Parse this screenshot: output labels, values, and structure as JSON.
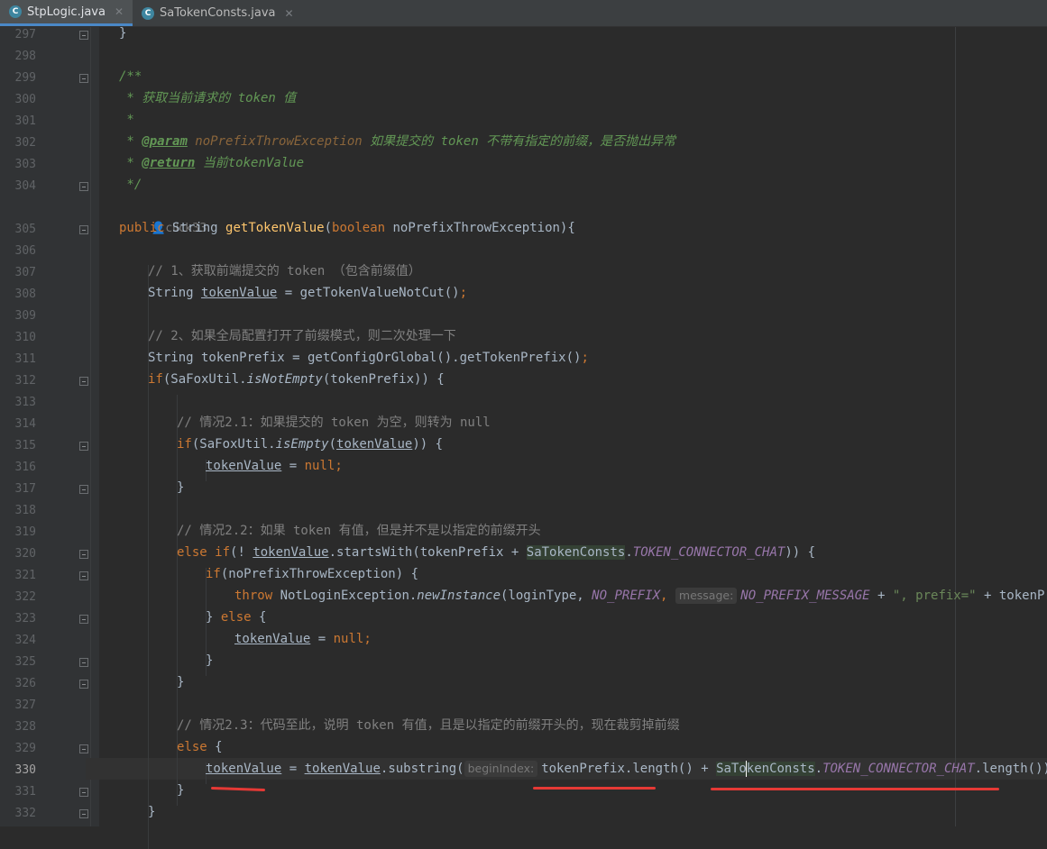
{
  "tabs": [
    {
      "label": "StpLogic.java",
      "icon": "C",
      "active": true
    },
    {
      "label": "SaTokenConsts.java",
      "icon": "C",
      "active": false
    }
  ],
  "gutter": [
    {
      "n": "297"
    },
    {
      "n": "298"
    },
    {
      "n": "299"
    },
    {
      "n": "300"
    },
    {
      "n": "301"
    },
    {
      "n": "302"
    },
    {
      "n": "303"
    },
    {
      "n": "304"
    },
    {
      "n": ""
    },
    {
      "n": "305"
    },
    {
      "n": "306"
    },
    {
      "n": "307"
    },
    {
      "n": "308"
    },
    {
      "n": "309"
    },
    {
      "n": "310"
    },
    {
      "n": "311"
    },
    {
      "n": "312"
    },
    {
      "n": "313"
    },
    {
      "n": "314"
    },
    {
      "n": "315"
    },
    {
      "n": "316"
    },
    {
      "n": "317"
    },
    {
      "n": "318"
    },
    {
      "n": "319"
    },
    {
      "n": "320"
    },
    {
      "n": "321"
    },
    {
      "n": "322"
    },
    {
      "n": "323"
    },
    {
      "n": "324"
    },
    {
      "n": "325"
    },
    {
      "n": "326"
    },
    {
      "n": "327"
    },
    {
      "n": "328"
    },
    {
      "n": "329"
    },
    {
      "n": "330",
      "current": true
    },
    {
      "n": "331"
    },
    {
      "n": "332"
    }
  ],
  "code": {
    "l297": "}",
    "l299": "/**",
    "l300": " * 获取当前请求的 token 值",
    "l301": " *",
    "l302_star": " * ",
    "l302_tag": "@param",
    "l302_ref": " noPrefixThrowException",
    "l302_text": " 如果提交的 token 不带有指定的前缀，是否抛出异常",
    "l303_star": " * ",
    "l303_tag": "@return",
    "l303_text": " 当前tokenValue",
    "l304": " */",
    "author_icon": "user-icon",
    "author": "click33",
    "l305": {
      "kw1": "public ",
      "type": "String ",
      "name": "getTokenValue",
      "p1": "(",
      "kw2": "boolean",
      "rest": " noPrefixThrowException){"
    },
    "l307": "// 1、获取前端提交的 token （包含前缀值）",
    "l308": {
      "type": "String ",
      "var": "tokenValue",
      "rest": " = getTokenValueNotCut()",
      "semi": ";"
    },
    "l310": "// 2、如果全局配置打开了前缀模式，则二次处理一下",
    "l311": {
      "type": "String tokenPrefix = getConfigOrGlobal().getTokenPrefix()",
      "semi": ";"
    },
    "l312": {
      "kw": "if",
      "a": "(SaFoxUtil.",
      "m": "isNotEmpty",
      "b": "(tokenPrefix)) {"
    },
    "l314": "// 情况2.1：如果提交的 token 为空，则转为 null",
    "l315": {
      "kw": "if",
      "a": "(SaFoxUtil.",
      "m": "isEmpty",
      "b": "(",
      "var": "tokenValue",
      "c": ")) {"
    },
    "l316": {
      "var": "tokenValue",
      "eq": " = ",
      "kw": "null",
      "semi": ";"
    },
    "l317": "}",
    "l319": "// 情况2.2：如果 token 有值，但是并不是以指定的前缀开头",
    "l320": {
      "kw": "else if",
      "a": "(! ",
      "var": "tokenValue",
      "b": ".startsWith(tokenPrefix + ",
      "cls": "SaTokenConsts",
      "dot": ".",
      "const": "TOKEN_CONNECTOR_CHAT",
      "c": ")) {"
    },
    "l321": {
      "kw": "if",
      "rest": "(noPrefixThrowException) {"
    },
    "l322": {
      "kw": "throw ",
      "a": "NotLoginException.",
      "m": "newInstance",
      "b": "(loginType, ",
      "c1": "NO_PREFIX",
      "comma": ", ",
      "hint": "message:",
      "c2": "NO_PREFIX_MESSAGE",
      "plus": " + ",
      "str": "\", prefix=\"",
      "tail": " + tokenPrefix, "
    },
    "l323": {
      "a": "} ",
      "kw": "else",
      "b": " {"
    },
    "l324": {
      "var": "tokenValue",
      "eq": " = ",
      "kw": "null",
      "semi": ";"
    },
    "l325": "}",
    "l326": "}",
    "l328": "// 情况2.3：代码至此，说明 token 有值，且是以指定的前缀开头的，现在裁剪掉前缀",
    "l329": {
      "kw": "else",
      "b": " {"
    },
    "l330": {
      "var1": "tokenValue",
      "eq": " = ",
      "var2": "tokenValue",
      "a": ".substring(",
      "hint": "beginIndex:",
      "b": "tokenPrefix.length() + ",
      "cls1": "SaTo",
      "cls2": "kenConsts",
      "dot": ".",
      "const": "TOKEN_CONNECTOR_CHAT",
      "c": ".length())",
      "semi": ";"
    },
    "l331": "}",
    "l332": "}"
  }
}
